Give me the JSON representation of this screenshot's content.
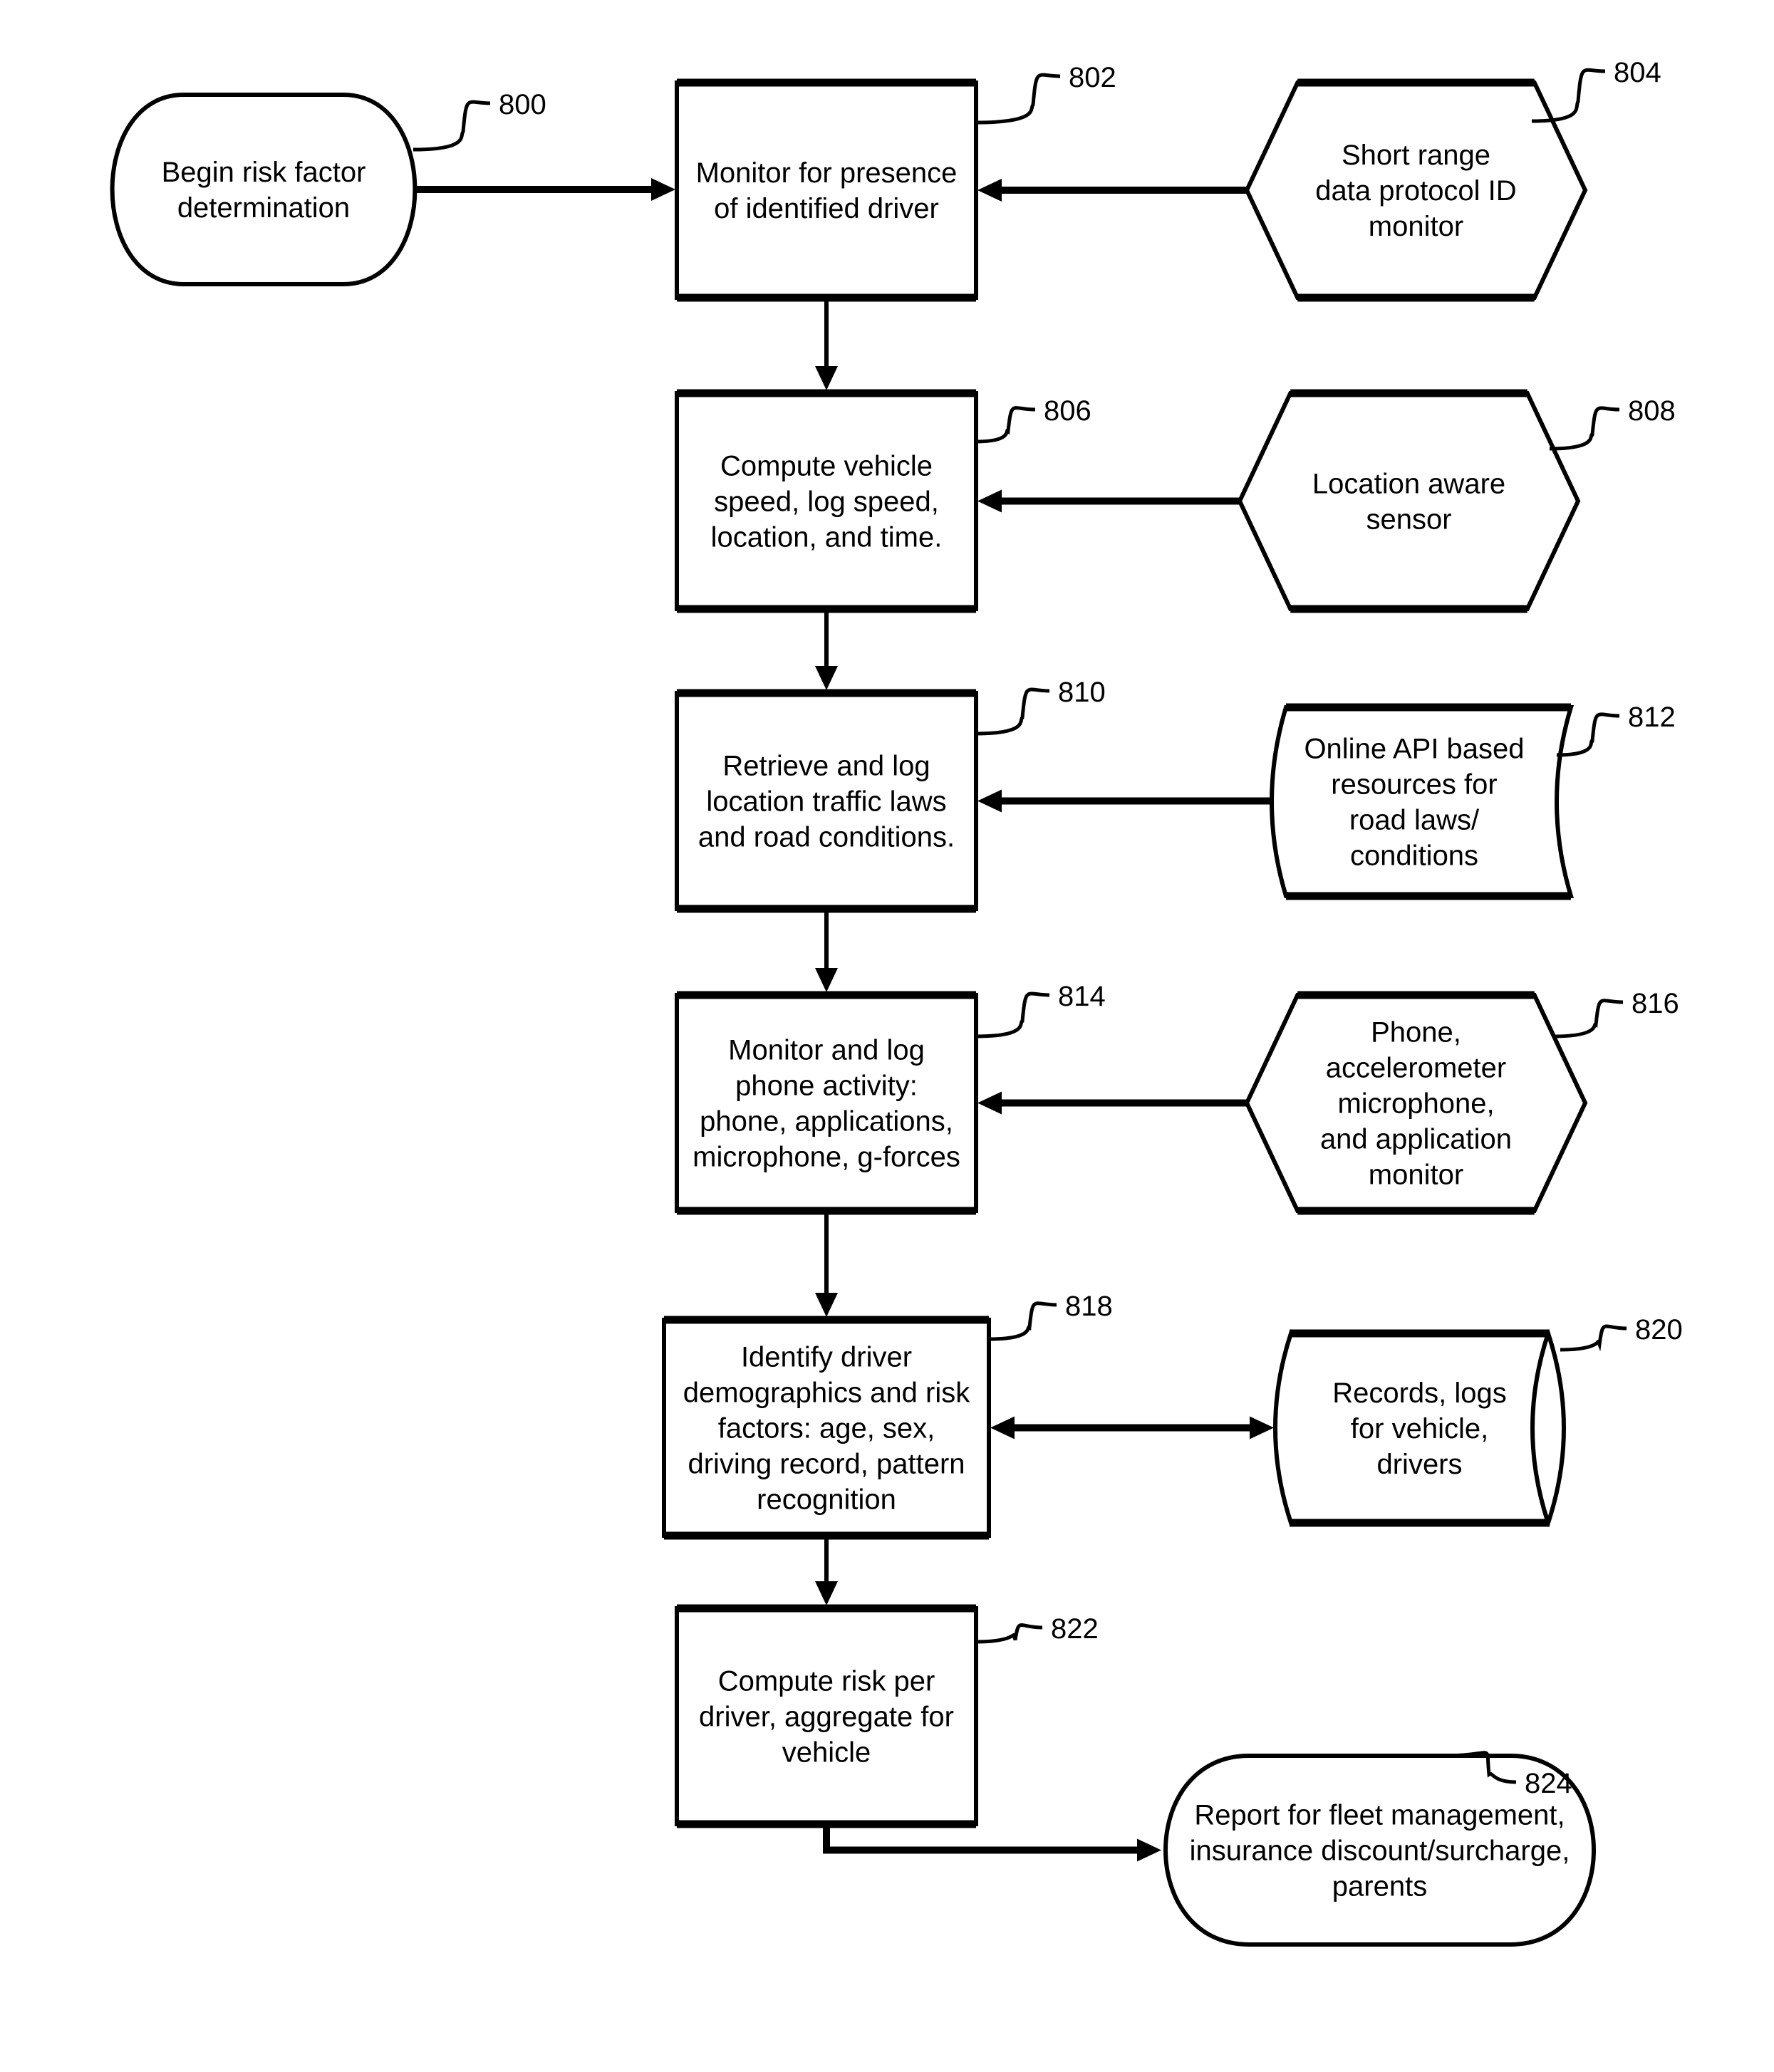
{
  "diagram": {
    "type": "flowchart",
    "nodes": [
      {
        "id": "800",
        "shape": "terminator",
        "lines": [
          "Begin risk factor",
          "determination"
        ]
      },
      {
        "id": "802",
        "shape": "process",
        "lines": [
          "Monitor for presence",
          "of identified driver"
        ]
      },
      {
        "id": "804",
        "shape": "hexagon",
        "lines": [
          "Short range",
          "data protocol ID",
          "monitor"
        ]
      },
      {
        "id": "806",
        "shape": "process",
        "lines": [
          "Compute vehicle",
          "speed, log speed,",
          "location, and time."
        ]
      },
      {
        "id": "808",
        "shape": "hexagon",
        "lines": [
          "Location aware",
          "sensor"
        ]
      },
      {
        "id": "810",
        "shape": "process",
        "lines": [
          "Retrieve and log",
          "location traffic laws",
          "and road conditions."
        ]
      },
      {
        "id": "812",
        "shape": "stored-data",
        "lines": [
          "Online API based",
          "resources for",
          "road laws/",
          "conditions"
        ]
      },
      {
        "id": "814",
        "shape": "process",
        "lines": [
          "Monitor and log",
          "phone activity:",
          "phone, applications,",
          "microphone, g-forces"
        ]
      },
      {
        "id": "816",
        "shape": "hexagon",
        "lines": [
          "Phone,",
          "accelerometer",
          "microphone,",
          "and application",
          "monitor"
        ]
      },
      {
        "id": "818",
        "shape": "process",
        "lines": [
          "Identify driver",
          "demographics and risk",
          "factors: age, sex,",
          "driving record, pattern",
          "recognition"
        ]
      },
      {
        "id": "820",
        "shape": "database",
        "lines": [
          "Records, logs",
          "for vehicle,",
          "drivers"
        ]
      },
      {
        "id": "822",
        "shape": "process",
        "lines": [
          "Compute risk per",
          "driver, aggregate for",
          "vehicle"
        ]
      },
      {
        "id": "824",
        "shape": "terminator",
        "lines": [
          "Report for fleet management,",
          "insurance discount/surcharge,",
          "parents"
        ]
      }
    ],
    "edges": [
      {
        "from": "800",
        "to": "802",
        "direction": "forward"
      },
      {
        "from": "804",
        "to": "802",
        "direction": "forward"
      },
      {
        "from": "802",
        "to": "806",
        "direction": "forward"
      },
      {
        "from": "808",
        "to": "806",
        "direction": "forward"
      },
      {
        "from": "806",
        "to": "810",
        "direction": "forward"
      },
      {
        "from": "812",
        "to": "810",
        "direction": "forward"
      },
      {
        "from": "810",
        "to": "814",
        "direction": "forward"
      },
      {
        "from": "816",
        "to": "814",
        "direction": "forward"
      },
      {
        "from": "814",
        "to": "818",
        "direction": "forward"
      },
      {
        "from": "818",
        "to": "820",
        "direction": "bidirectional"
      },
      {
        "from": "818",
        "to": "822",
        "direction": "forward"
      },
      {
        "from": "822",
        "to": "824",
        "direction": "forward"
      }
    ]
  }
}
